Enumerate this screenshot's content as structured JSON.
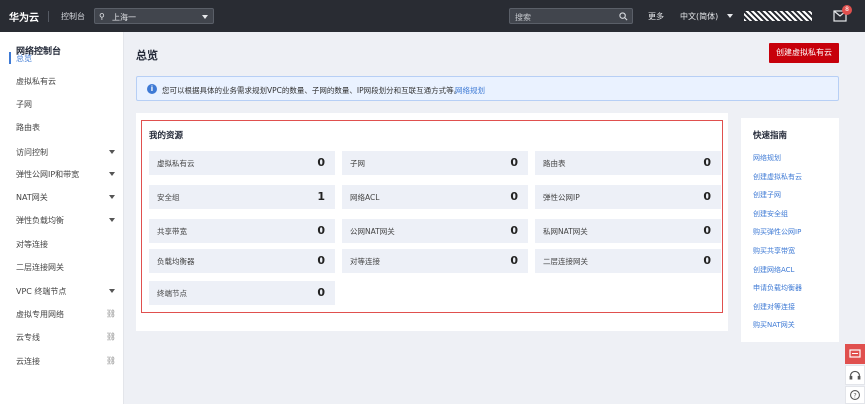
{
  "topbar": {
    "brand": "华为云",
    "console": "控制台",
    "region": "上海一",
    "search_placeholder": "搜索",
    "more": "更多",
    "language": "中文(简体)",
    "notification_count": "8"
  },
  "sidebar": {
    "title": "网络控制台",
    "items": [
      {
        "label": "总览",
        "active": true,
        "suffix": ""
      },
      {
        "label": "虚拟私有云",
        "suffix": ""
      },
      {
        "label": "子网",
        "suffix": ""
      },
      {
        "label": "路由表",
        "suffix": ""
      },
      {
        "label": "访问控制",
        "suffix": "caret"
      },
      {
        "label": "弹性公网IP和带宽",
        "suffix": "caret"
      },
      {
        "label": "NAT网关",
        "suffix": "caret"
      },
      {
        "label": "弹性负载均衡",
        "suffix": "caret"
      },
      {
        "label": "对等连接",
        "suffix": ""
      },
      {
        "label": "二层连接网关",
        "suffix": ""
      },
      {
        "label": "VPC 终端节点",
        "suffix": "caret"
      },
      {
        "label": "虚拟专用网络",
        "suffix": "ext"
      },
      {
        "label": "云专线",
        "suffix": "ext"
      },
      {
        "label": "云连接",
        "suffix": "ext"
      }
    ]
  },
  "main": {
    "title": "总览",
    "create_button": "创建虚拟私有云",
    "info": {
      "message": "您可以根据具体的业务需求规划VPC的数量、子网的数量、IP网段划分和互联互通方式等。",
      "link": "网络规划"
    },
    "resources": {
      "title": "我的资源",
      "tiles": [
        {
          "name": "虚拟私有云",
          "value": "0"
        },
        {
          "name": "子网",
          "value": "0"
        },
        {
          "name": "路由表",
          "value": "0"
        },
        {
          "name": "安全组",
          "value": "1"
        },
        {
          "name": "网络ACL",
          "value": "0"
        },
        {
          "name": "弹性公网IP",
          "value": "0"
        },
        {
          "name": "共享带宽",
          "value": "0"
        },
        {
          "name": "公网NAT网关",
          "value": "0"
        },
        {
          "name": "私网NAT网关",
          "value": "0"
        },
        {
          "name": "负载均衡器",
          "value": "0"
        },
        {
          "name": "对等连接",
          "value": "0"
        },
        {
          "name": "二层连接网关",
          "value": "0"
        },
        {
          "name": "终端节点",
          "value": "0"
        }
      ]
    },
    "guide": {
      "title": "快速指南",
      "links": [
        "网络规划",
        "创建虚拟私有云",
        "创建子网",
        "创建安全组",
        "购买弹性公网IP",
        "购买共享带宽",
        "创建网络ACL",
        "申请负载均衡器",
        "创建对等连接",
        "购买NAT网关"
      ]
    }
  },
  "colors": {
    "brand_red": "#c7000b",
    "link_blue": "#3e7ad5",
    "topbar": "#292c33"
  }
}
